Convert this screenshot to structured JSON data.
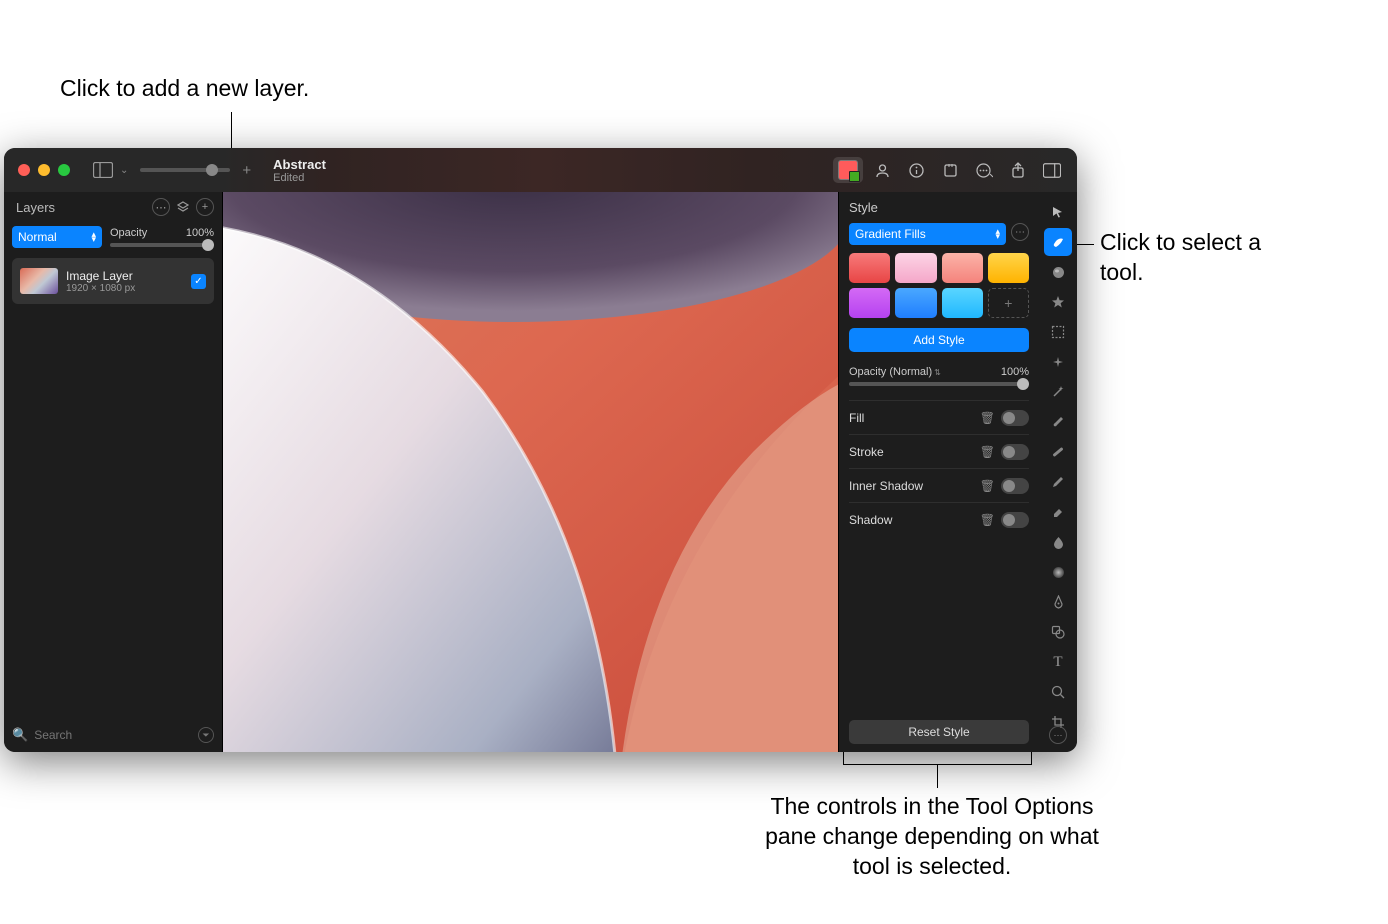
{
  "annotations": {
    "top": "Click to add a new layer.",
    "right": "Click to select a tool.",
    "bottom": "The controls in the Tool Options pane change depending on what tool is selected."
  },
  "titlebar": {
    "title": "Abstract",
    "subtitle": "Edited"
  },
  "layers_panel": {
    "title": "Layers",
    "blend_mode": "Normal",
    "opacity_label": "Opacity",
    "opacity_value": "100%",
    "layer": {
      "name": "Image Layer",
      "dimensions": "1920 × 1080 px"
    },
    "search_placeholder": "Search"
  },
  "style_panel": {
    "title": "Style",
    "preset_group": "Gradient Fills",
    "swatches": [
      "linear-gradient(180deg,#f77a7a,#e84545)",
      "linear-gradient(180deg,#fcd4e5,#f5a7c9)",
      "linear-gradient(180deg,#fbb3a8,#f5837c)",
      "linear-gradient(180deg,#ffd54a,#ffb300)",
      "linear-gradient(180deg,#d46af5,#b642f0)",
      "linear-gradient(180deg,#4aa8ff,#1f7eff)",
      "linear-gradient(180deg,#5ad5ff,#1fb8ff)"
    ],
    "add_style_label": "Add Style",
    "opacity_label": "Opacity (Normal)",
    "opacity_value": "100%",
    "props": [
      "Fill",
      "Stroke",
      "Inner Shadow",
      "Shadow"
    ],
    "reset_label": "Reset Style"
  }
}
